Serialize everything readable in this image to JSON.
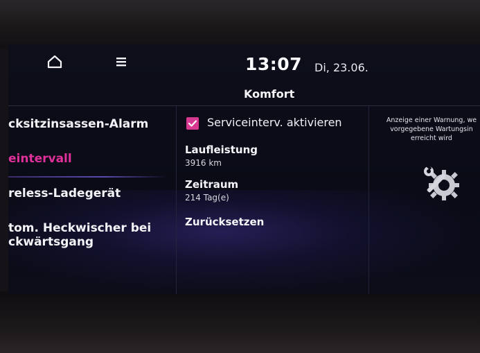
{
  "header": {
    "time": "13:07",
    "date": "Di, 23.06.",
    "title": "Komfort"
  },
  "sidebar": {
    "items": [
      {
        "label": "cksitzinsassen-Alarm",
        "active": false
      },
      {
        "label": "eintervall",
        "active": true
      },
      {
        "label": "reless-Ladegerät",
        "active": false
      },
      {
        "label": "tom. Heckwischer bei\nckwärtsgang",
        "active": false
      }
    ]
  },
  "settings": {
    "service_toggle_label": "Serviceinterv. aktivieren",
    "service_toggle_checked": true,
    "mileage_title": "Laufleistung",
    "mileage_value": "3916 km",
    "period_title": "Zeitraum",
    "period_value": "214 Tag(e)",
    "reset_label": "Zurücksetzen"
  },
  "info_panel": {
    "text": "Anzeige einer Warnung, we\nvorgegebene Wartungsin\nerreicht wird",
    "icon": "wrench-gear-icon"
  },
  "colors": {
    "accent": "#e0309a",
    "checkbox": "#d6398f",
    "background": "#0b0c18"
  }
}
